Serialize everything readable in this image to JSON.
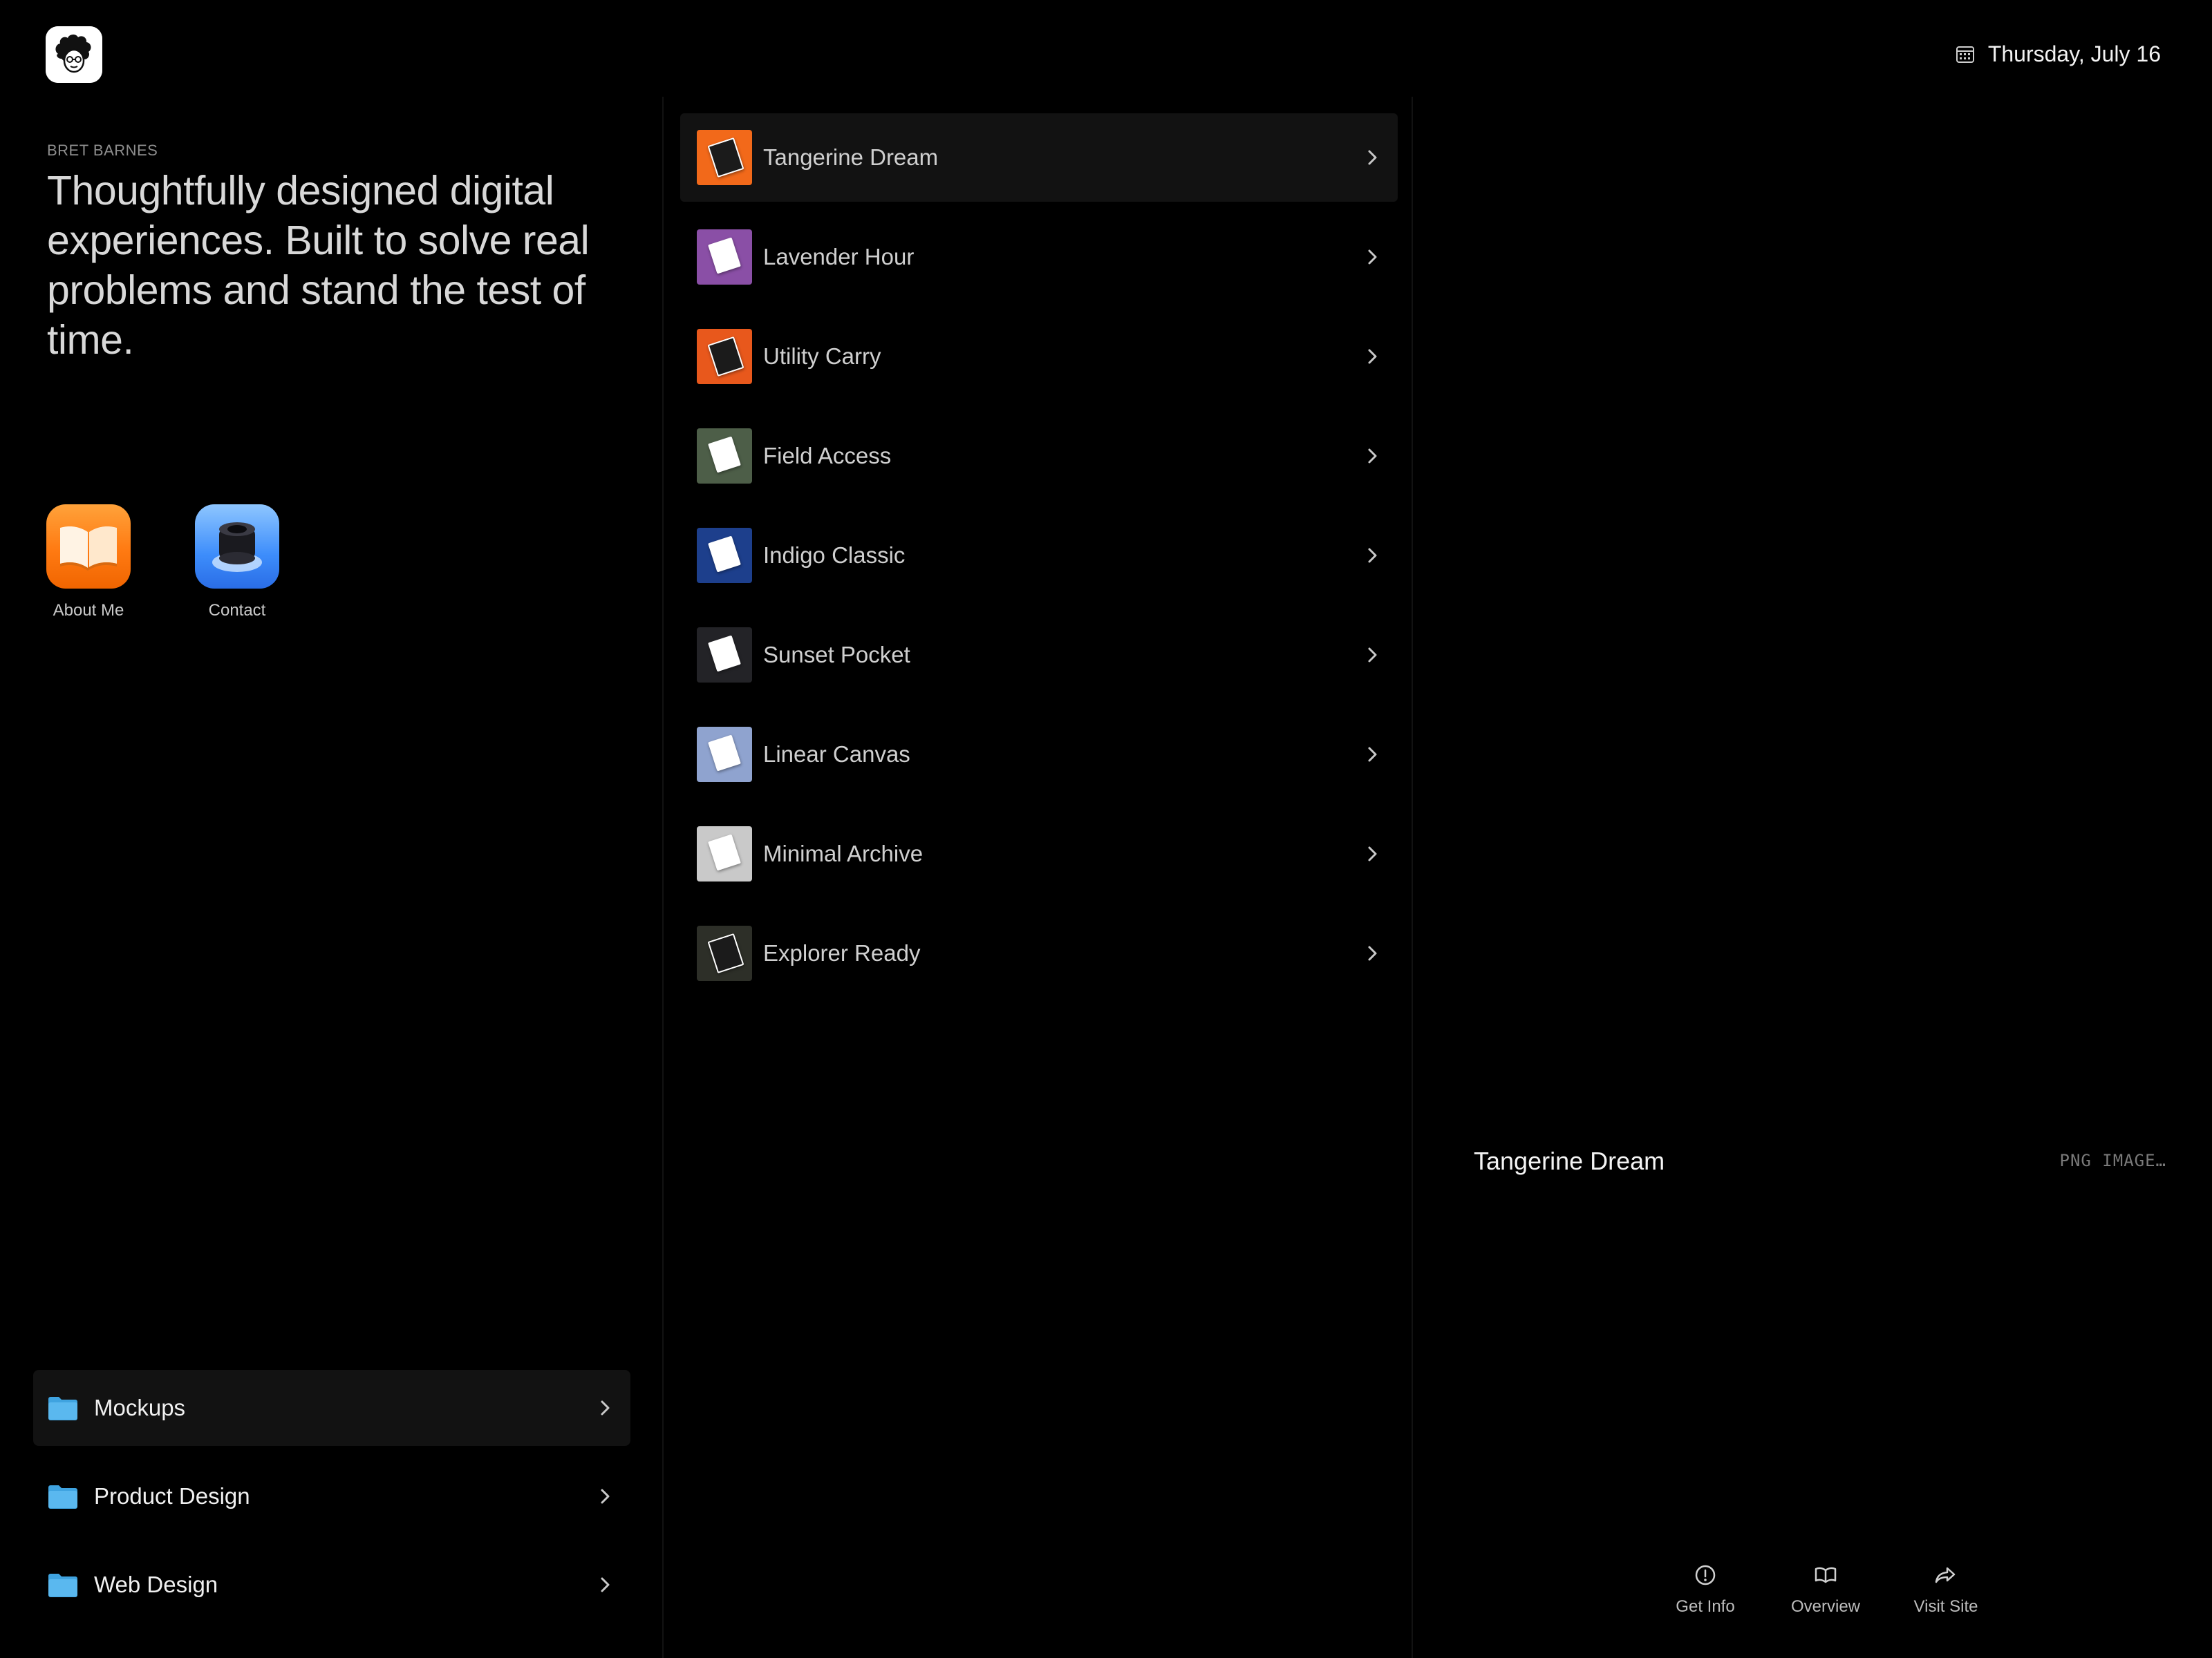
{
  "header": {
    "logo_icon": "avatar-logo-icon",
    "date": "Thursday, July 16",
    "date_icon": "calendar-icon"
  },
  "intro": {
    "kicker": "BRET BARNES",
    "tagline": "Thoughtfully designed digital experiences. Built to solve real problems and stand the test of time."
  },
  "apps": [
    {
      "label": "About Me",
      "icon": "book-app-icon"
    },
    {
      "label": "Contact",
      "icon": "contact-app-icon"
    }
  ],
  "folders": [
    {
      "label": "Mockups",
      "icon": "folder-icon",
      "active": true
    },
    {
      "label": "Product Design",
      "icon": "folder-icon",
      "active": false
    },
    {
      "label": "Web Design",
      "icon": "folder-icon",
      "active": false
    }
  ],
  "items": [
    {
      "label": "Tangerine Dream",
      "color": "#f2691a",
      "active": true
    },
    {
      "label": "Lavender Hour",
      "color": "#8a4fa6"
    },
    {
      "label": "Utility Carry",
      "color": "#e8581c"
    },
    {
      "label": "Field Access",
      "color": "#4d5e48"
    },
    {
      "label": "Indigo Classic",
      "color": "#1d3f8c"
    },
    {
      "label": "Sunset Pocket",
      "color": "#232327"
    },
    {
      "label": "Linear Canvas",
      "color": "#8fa3cf"
    },
    {
      "label": "Minimal Archive",
      "color": "#c9c9c9"
    },
    {
      "label": "Explorer Ready",
      "color": "#2d2f28"
    }
  ],
  "preview": {
    "title": "Tangerine Dream",
    "meta": "PNG IMAGE…"
  },
  "actions": [
    {
      "label": "Get Info",
      "icon": "info-icon"
    },
    {
      "label": "Overview",
      "icon": "book-open-icon"
    },
    {
      "label": "Visit Site",
      "icon": "share-arrow-icon"
    }
  ],
  "colors": {
    "background": "#000000",
    "row_active": "#121212",
    "folder_blue": "#5ab8ef"
  }
}
